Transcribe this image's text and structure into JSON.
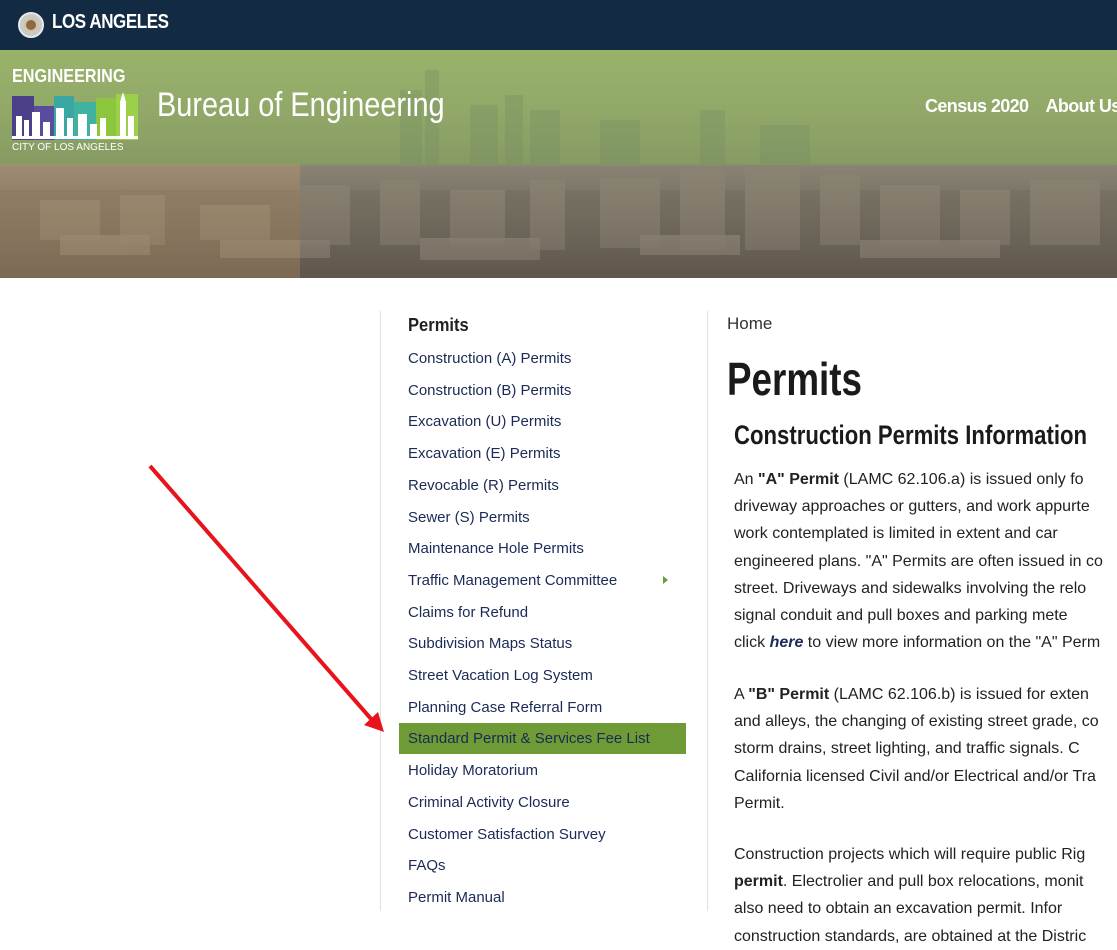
{
  "topbar": {
    "city_name": "LOS ANGELES"
  },
  "header": {
    "logo_top": "ENGINEERING",
    "logo_bottom": "CITY OF LOS ANGELES",
    "title": "Bureau of Engineering",
    "nav": [
      "Census 2020",
      "About Us"
    ]
  },
  "sidebar": {
    "title": "Permits",
    "items": [
      {
        "label": "Construction (A) Permits"
      },
      {
        "label": "Construction (B) Permits"
      },
      {
        "label": "Excavation (U) Permits"
      },
      {
        "label": "Excavation (E) Permits"
      },
      {
        "label": "Revocable (R) Permits"
      },
      {
        "label": "Sewer (S) Permits"
      },
      {
        "label": "Maintenance Hole Permits"
      },
      {
        "label": "Traffic Management Committee"
      },
      {
        "label": "Claims for Refund"
      },
      {
        "label": "Subdivision Maps Status"
      },
      {
        "label": "Street Vacation Log System"
      },
      {
        "label": "Planning Case Referral Form"
      },
      {
        "label": "Standard Permit & Services Fee List"
      },
      {
        "label": "Holiday Moratorium"
      },
      {
        "label": "Criminal Activity Closure"
      },
      {
        "label": "Customer Satisfaction Survey"
      },
      {
        "label": "FAQs"
      },
      {
        "label": "Permit Manual"
      }
    ],
    "active_index": 12
  },
  "main": {
    "breadcrumb": "Home",
    "page_title": "Permits",
    "section_title": "Construction Permits Information",
    "p1": {
      "l1_a": "An ",
      "l1_b": "\"A\" Permit",
      "l1_c": " (LAMC 62.106.a) is issued only fo",
      "l2": "driveway approaches or gutters, and work appurte",
      "l3": "work contemplated is limited in extent and car",
      "l4": "engineered plans. \"A\" Permits are often issued in co",
      "l5": "street. Driveways and sidewalks involving the relo",
      "l6": "signal conduit and pull boxes and parking mete",
      "l7_a": "click ",
      "l7_link": "here",
      "l7_b": " to view more information on the \"A\" Perm"
    },
    "p2": {
      "l1_a": "A ",
      "l1_b": "\"B\" Permit",
      "l1_c": " (LAMC 62.106.b) is issued for exten",
      "l2": "and alleys, the changing of existing street grade, co",
      "l3": "storm drains, street lighting, and traffic signals. C",
      "l4": "California licensed Civil and/or Electrical and/or Tra",
      "l5": "Permit."
    },
    "p3": {
      "l1": "Construction projects which will require public Rig",
      "l2_a": "permit",
      "l2_b": ". Electrolier and pull box relocations, monit",
      "l3": "also need to obtain an excavation permit. Infor",
      "l4": "construction standards, are obtained at the Distric"
    }
  }
}
